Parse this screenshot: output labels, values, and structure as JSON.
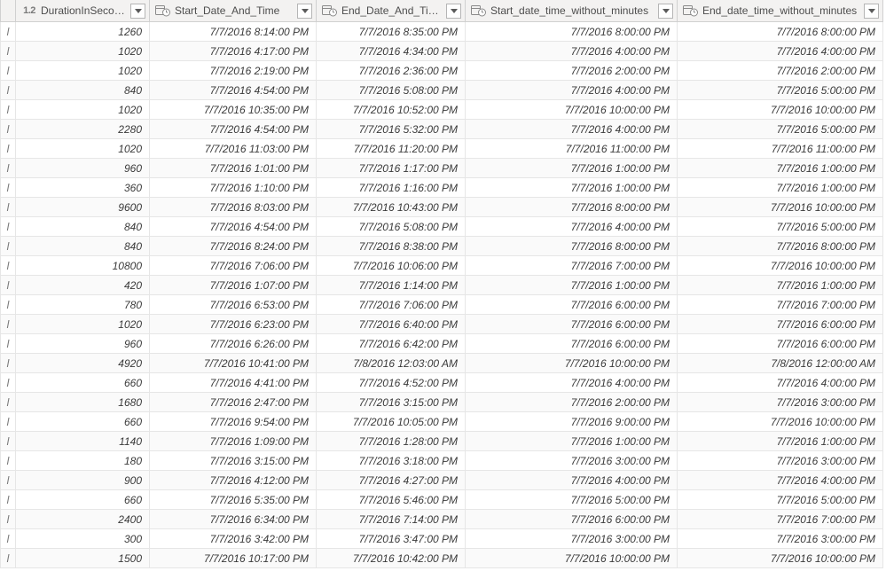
{
  "columns": [
    {
      "name": "DurationInSeconds",
      "type": "number"
    },
    {
      "name": "Start_Date_And_Time",
      "type": "datetime"
    },
    {
      "name": "End_Date_And_Time",
      "type": "datetime"
    },
    {
      "name": "Start_date_time_without_minutes",
      "type": "datetime"
    },
    {
      "name": "End_date_time_without_minutes",
      "type": "datetime"
    }
  ],
  "number_type_label": "1.2",
  "stub_marker": "l",
  "rows": [
    {
      "dur": "1260",
      "start": "7/7/2016 8:14:00 PM",
      "end": "7/7/2016 8:35:00 PM",
      "start_nm": "7/7/2016 8:00:00 PM",
      "end_nm": "7/7/2016 8:00:00 PM"
    },
    {
      "dur": "1020",
      "start": "7/7/2016 4:17:00 PM",
      "end": "7/7/2016 4:34:00 PM",
      "start_nm": "7/7/2016 4:00:00 PM",
      "end_nm": "7/7/2016 4:00:00 PM"
    },
    {
      "dur": "1020",
      "start": "7/7/2016 2:19:00 PM",
      "end": "7/7/2016 2:36:00 PM",
      "start_nm": "7/7/2016 2:00:00 PM",
      "end_nm": "7/7/2016 2:00:00 PM"
    },
    {
      "dur": "840",
      "start": "7/7/2016 4:54:00 PM",
      "end": "7/7/2016 5:08:00 PM",
      "start_nm": "7/7/2016 4:00:00 PM",
      "end_nm": "7/7/2016 5:00:00 PM"
    },
    {
      "dur": "1020",
      "start": "7/7/2016 10:35:00 PM",
      "end": "7/7/2016 10:52:00 PM",
      "start_nm": "7/7/2016 10:00:00 PM",
      "end_nm": "7/7/2016 10:00:00 PM"
    },
    {
      "dur": "2280",
      "start": "7/7/2016 4:54:00 PM",
      "end": "7/7/2016 5:32:00 PM",
      "start_nm": "7/7/2016 4:00:00 PM",
      "end_nm": "7/7/2016 5:00:00 PM"
    },
    {
      "dur": "1020",
      "start": "7/7/2016 11:03:00 PM",
      "end": "7/7/2016 11:20:00 PM",
      "start_nm": "7/7/2016 11:00:00 PM",
      "end_nm": "7/7/2016 11:00:00 PM"
    },
    {
      "dur": "960",
      "start": "7/7/2016 1:01:00 PM",
      "end": "7/7/2016 1:17:00 PM",
      "start_nm": "7/7/2016 1:00:00 PM",
      "end_nm": "7/7/2016 1:00:00 PM"
    },
    {
      "dur": "360",
      "start": "7/7/2016 1:10:00 PM",
      "end": "7/7/2016 1:16:00 PM",
      "start_nm": "7/7/2016 1:00:00 PM",
      "end_nm": "7/7/2016 1:00:00 PM"
    },
    {
      "dur": "9600",
      "start": "7/7/2016 8:03:00 PM",
      "end": "7/7/2016 10:43:00 PM",
      "start_nm": "7/7/2016 8:00:00 PM",
      "end_nm": "7/7/2016 10:00:00 PM"
    },
    {
      "dur": "840",
      "start": "7/7/2016 4:54:00 PM",
      "end": "7/7/2016 5:08:00 PM",
      "start_nm": "7/7/2016 4:00:00 PM",
      "end_nm": "7/7/2016 5:00:00 PM"
    },
    {
      "dur": "840",
      "start": "7/7/2016 8:24:00 PM",
      "end": "7/7/2016 8:38:00 PM",
      "start_nm": "7/7/2016 8:00:00 PM",
      "end_nm": "7/7/2016 8:00:00 PM"
    },
    {
      "dur": "10800",
      "start": "7/7/2016 7:06:00 PM",
      "end": "7/7/2016 10:06:00 PM",
      "start_nm": "7/7/2016 7:00:00 PM",
      "end_nm": "7/7/2016 10:00:00 PM"
    },
    {
      "dur": "420",
      "start": "7/7/2016 1:07:00 PM",
      "end": "7/7/2016 1:14:00 PM",
      "start_nm": "7/7/2016 1:00:00 PM",
      "end_nm": "7/7/2016 1:00:00 PM"
    },
    {
      "dur": "780",
      "start": "7/7/2016 6:53:00 PM",
      "end": "7/7/2016 7:06:00 PM",
      "start_nm": "7/7/2016 6:00:00 PM",
      "end_nm": "7/7/2016 7:00:00 PM"
    },
    {
      "dur": "1020",
      "start": "7/7/2016 6:23:00 PM",
      "end": "7/7/2016 6:40:00 PM",
      "start_nm": "7/7/2016 6:00:00 PM",
      "end_nm": "7/7/2016 6:00:00 PM"
    },
    {
      "dur": "960",
      "start": "7/7/2016 6:26:00 PM",
      "end": "7/7/2016 6:42:00 PM",
      "start_nm": "7/7/2016 6:00:00 PM",
      "end_nm": "7/7/2016 6:00:00 PM"
    },
    {
      "dur": "4920",
      "start": "7/7/2016 10:41:00 PM",
      "end": "7/8/2016 12:03:00 AM",
      "start_nm": "7/7/2016 10:00:00 PM",
      "end_nm": "7/8/2016 12:00:00 AM"
    },
    {
      "dur": "660",
      "start": "7/7/2016 4:41:00 PM",
      "end": "7/7/2016 4:52:00 PM",
      "start_nm": "7/7/2016 4:00:00 PM",
      "end_nm": "7/7/2016 4:00:00 PM"
    },
    {
      "dur": "1680",
      "start": "7/7/2016 2:47:00 PM",
      "end": "7/7/2016 3:15:00 PM",
      "start_nm": "7/7/2016 2:00:00 PM",
      "end_nm": "7/7/2016 3:00:00 PM"
    },
    {
      "dur": "660",
      "start": "7/7/2016 9:54:00 PM",
      "end": "7/7/2016 10:05:00 PM",
      "start_nm": "7/7/2016 9:00:00 PM",
      "end_nm": "7/7/2016 10:00:00 PM"
    },
    {
      "dur": "1140",
      "start": "7/7/2016 1:09:00 PM",
      "end": "7/7/2016 1:28:00 PM",
      "start_nm": "7/7/2016 1:00:00 PM",
      "end_nm": "7/7/2016 1:00:00 PM"
    },
    {
      "dur": "180",
      "start": "7/7/2016 3:15:00 PM",
      "end": "7/7/2016 3:18:00 PM",
      "start_nm": "7/7/2016 3:00:00 PM",
      "end_nm": "7/7/2016 3:00:00 PM"
    },
    {
      "dur": "900",
      "start": "7/7/2016 4:12:00 PM",
      "end": "7/7/2016 4:27:00 PM",
      "start_nm": "7/7/2016 4:00:00 PM",
      "end_nm": "7/7/2016 4:00:00 PM"
    },
    {
      "dur": "660",
      "start": "7/7/2016 5:35:00 PM",
      "end": "7/7/2016 5:46:00 PM",
      "start_nm": "7/7/2016 5:00:00 PM",
      "end_nm": "7/7/2016 5:00:00 PM"
    },
    {
      "dur": "2400",
      "start": "7/7/2016 6:34:00 PM",
      "end": "7/7/2016 7:14:00 PM",
      "start_nm": "7/7/2016 6:00:00 PM",
      "end_nm": "7/7/2016 7:00:00 PM"
    },
    {
      "dur": "300",
      "start": "7/7/2016 3:42:00 PM",
      "end": "7/7/2016 3:47:00 PM",
      "start_nm": "7/7/2016 3:00:00 PM",
      "end_nm": "7/7/2016 3:00:00 PM"
    },
    {
      "dur": "1500",
      "start": "7/7/2016 10:17:00 PM",
      "end": "7/7/2016 10:42:00 PM",
      "start_nm": "7/7/2016 10:00:00 PM",
      "end_nm": "7/7/2016 10:00:00 PM"
    }
  ]
}
